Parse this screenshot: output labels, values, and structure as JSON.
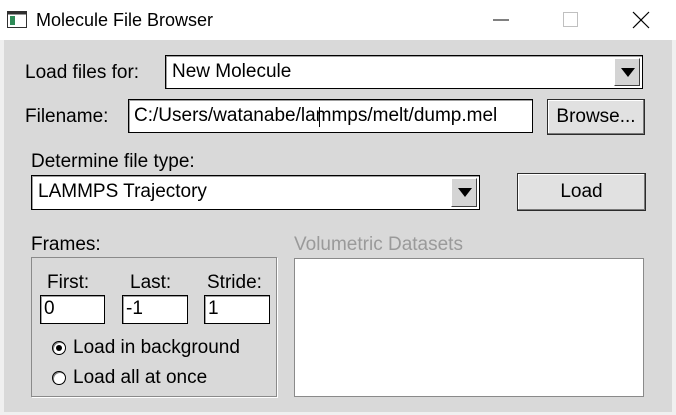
{
  "window": {
    "title": "Molecule File Browser"
  },
  "load_for": {
    "label": "Load files for:",
    "value": "New Molecule"
  },
  "filename": {
    "label": "Filename:",
    "value": "C:/Users/watanabe/lammps/melt/dump.mel",
    "browse_label": "Browse..."
  },
  "file_type": {
    "label": "Determine file type:",
    "value": "LAMMPS Trajectory",
    "load_label": "Load"
  },
  "frames": {
    "label": "Frames:",
    "first_label": "First:",
    "first_value": "0",
    "last_label": "Last:",
    "last_value": "-1",
    "stride_label": "Stride:",
    "stride_value": "1",
    "options": [
      {
        "label": "Load in background",
        "checked": true
      },
      {
        "label": "Load all at once",
        "checked": false
      }
    ]
  },
  "volumetric": {
    "label": "Volumetric Datasets"
  }
}
